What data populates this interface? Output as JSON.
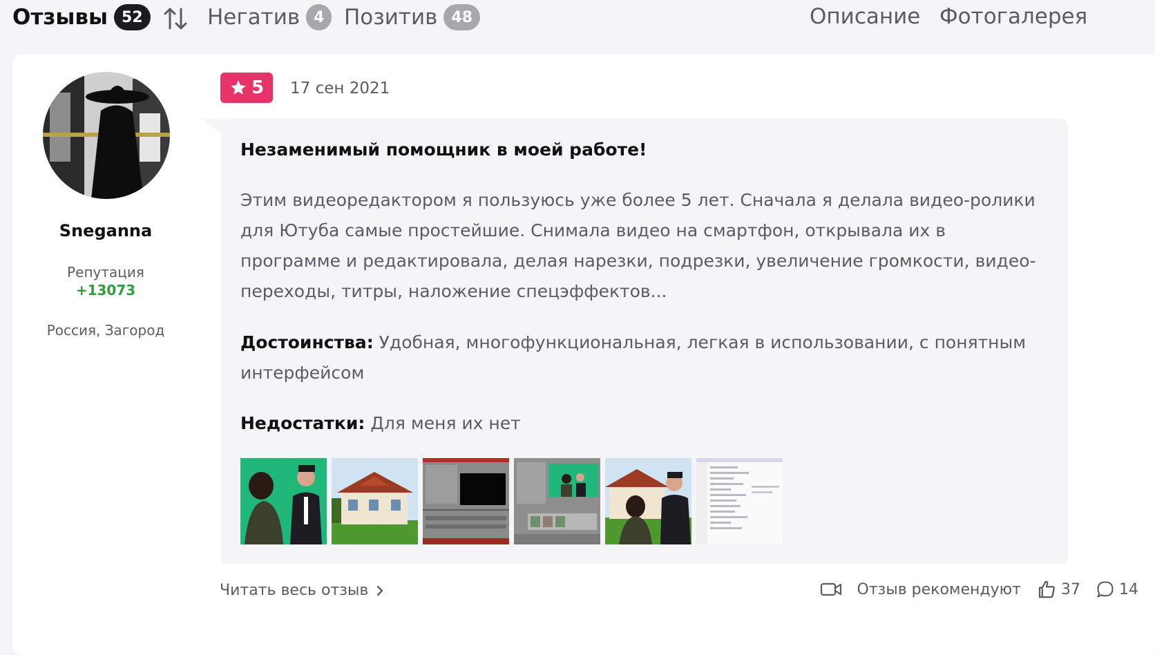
{
  "tabs": {
    "reviews_label": "Отзывы",
    "reviews_count": "52",
    "negative_label": "Негатив",
    "negative_count": "4",
    "positive_label": "Позитив",
    "positive_count": "48",
    "description_label": "Описание",
    "gallery_label": "Фотогалерея"
  },
  "author": {
    "name": "Sneganna",
    "reputation_label": "Репутация",
    "reputation_value": "+13073",
    "location": "Россия, Загород"
  },
  "review": {
    "rating": "5",
    "date": "17 сен 2021",
    "title": "Незаменимый помощник в моей работе!",
    "text": "Этим видеоредактором я пользуюсь уже более 5 лет. Сначала я делала видео-ролики для Ютуба самые простейшие. Снимала видео на смартфон, открывала их в программе и редактировала, делая нарезки, подрезки, увеличение громкости, видео-переходы, титры, наложение спецэффектов...",
    "pros_label": "Достоинства:",
    "pros": "Удобная, многофункциональная, легкая в использовании, с понятным интерфейсом",
    "cons_label": "Недостатки:",
    "cons": "Для меня их нет",
    "accent_color": "#e8336a"
  },
  "thumbnails": [
    "photo-green-screen",
    "photo-house",
    "photo-editor-black",
    "photo-editor-green",
    "photo-house-people",
    "photo-settings-list"
  ],
  "footer": {
    "read_more": "Читать весь отзыв",
    "recommend": "Отзыв рекомендуют",
    "likes": "37",
    "comments": "14"
  }
}
